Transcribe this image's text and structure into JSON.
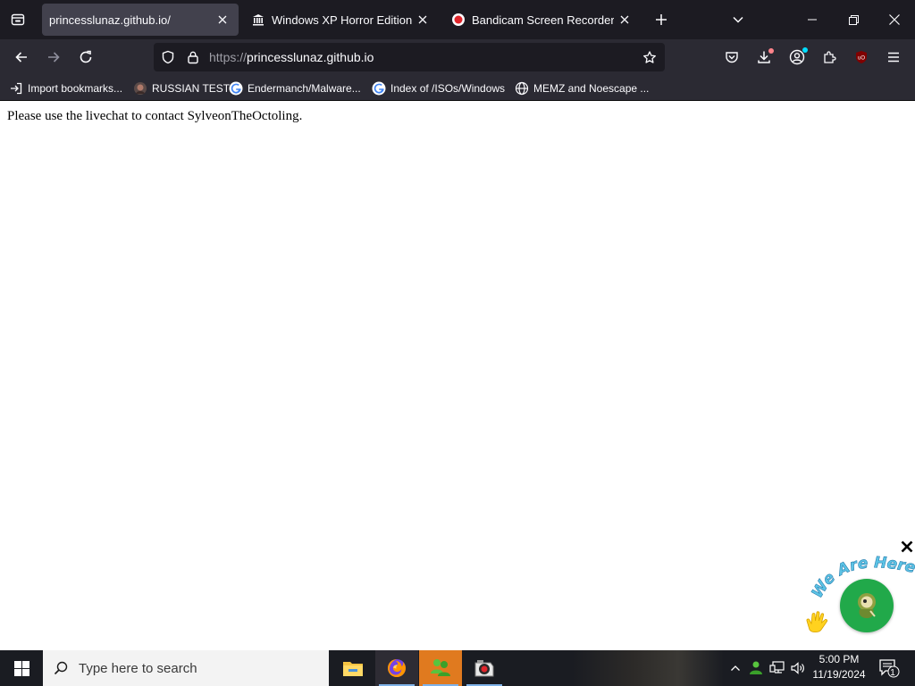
{
  "browser": {
    "tabs": [
      {
        "title": "princesslunaz.github.io/",
        "active": true,
        "favicon": "none"
      },
      {
        "title": "Windows XP Horror Edition (De",
        "active": false,
        "favicon": "archive-icon"
      },
      {
        "title": "Bandicam Screen Recorder Dow",
        "active": false,
        "favicon": "bandicam-record-icon"
      }
    ],
    "new_tab_label": "+",
    "url_scheme": "https://",
    "url_host": "princesslunaz.github.io",
    "bookmarks": [
      {
        "label": "Import bookmarks...",
        "icon": "import-icon"
      },
      {
        "label": "RUSSIAN TEST",
        "icon": "russian-test-icon"
      },
      {
        "label": "Endermanch/Malware...",
        "icon": "google-icon"
      },
      {
        "label": "Index of /ISOs/Windows",
        "icon": "google-icon"
      },
      {
        "label": "MEMZ and Noescape ...",
        "icon": "globe-icon"
      }
    ],
    "colors": {
      "tabstrip": "#1c1b22",
      "toolbar": "#2b2a33",
      "active_tab": "#42414d",
      "urlbar": "#1c1b22"
    }
  },
  "page": {
    "message": "Please use the livechat to contact SylveonTheOctoling."
  },
  "chat_widget": {
    "banner_text": "We Are Here!",
    "bubble_color": "#21a94a"
  },
  "taskbar": {
    "search_placeholder": "Type here to search",
    "apps": [
      "file-explorer-icon",
      "firefox-icon",
      "messenger-icon",
      "bandicam-icon"
    ],
    "time": "5:00 PM",
    "date": "11/19/2024",
    "notification_count": "1"
  }
}
